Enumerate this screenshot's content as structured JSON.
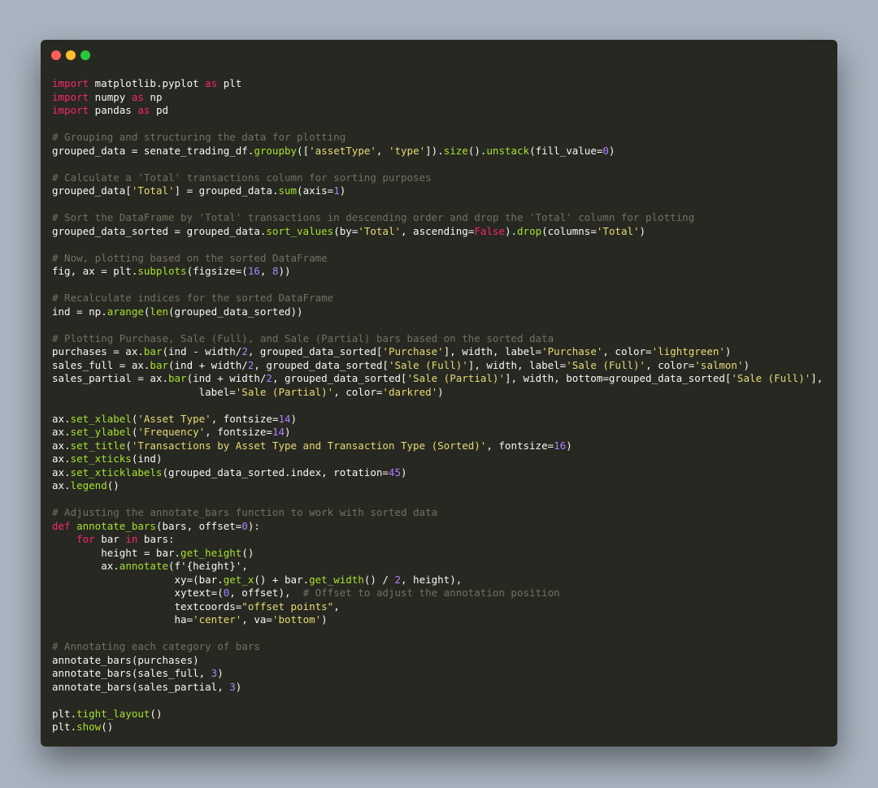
{
  "window": {
    "controls": [
      "close",
      "minimize",
      "maximize"
    ],
    "colors": {
      "close": "#ff5f56",
      "minimize": "#ffbd2e",
      "maximize": "#27c93f"
    }
  },
  "theme": {
    "background": "#272822",
    "page_background": "#a9b4c0",
    "colors": {
      "pl": "#f8f8f2",
      "kw": "#f92672",
      "fn": "#a6e22e",
      "str": "#e6db74",
      "num": "#ae81ff",
      "cm": "#75715e",
      "bool": "#ae81ff"
    }
  },
  "code_lines": [
    [
      [
        "kw",
        "import"
      ],
      [
        "pl",
        " matplotlib.pyplot "
      ],
      [
        "kw",
        "as"
      ],
      [
        "pl",
        " plt"
      ]
    ],
    [
      [
        "kw",
        "import"
      ],
      [
        "pl",
        " numpy "
      ],
      [
        "kw",
        "as"
      ],
      [
        "pl",
        " np"
      ]
    ],
    [
      [
        "kw",
        "import"
      ],
      [
        "pl",
        " pandas "
      ],
      [
        "kw",
        "as"
      ],
      [
        "pl",
        " pd"
      ]
    ],
    [],
    [
      [
        "cm",
        "# Grouping and structuring the data for plotting"
      ]
    ],
    [
      [
        "pl",
        "grouped_data = senate_trading_df."
      ],
      [
        "fn",
        "groupby"
      ],
      [
        "pl",
        "(["
      ],
      [
        "str",
        "'assetType'"
      ],
      [
        "pl",
        ", "
      ],
      [
        "str",
        "'type'"
      ],
      [
        "pl",
        "])."
      ],
      [
        "fn",
        "size"
      ],
      [
        "pl",
        "()."
      ],
      [
        "fn",
        "unstack"
      ],
      [
        "pl",
        "(fill_value="
      ],
      [
        "num",
        "0"
      ],
      [
        "pl",
        ")"
      ]
    ],
    [],
    [
      [
        "cm",
        "# Calculate a 'Total' transactions column for sorting purposes"
      ]
    ],
    [
      [
        "pl",
        "grouped_data["
      ],
      [
        "str",
        "'Total'"
      ],
      [
        "pl",
        "] = grouped_data."
      ],
      [
        "fn",
        "sum"
      ],
      [
        "pl",
        "(axis="
      ],
      [
        "num",
        "1"
      ],
      [
        "pl",
        ")"
      ]
    ],
    [],
    [
      [
        "cm",
        "# Sort the DataFrame by 'Total' transactions in descending order and drop the 'Total' column for plotting"
      ]
    ],
    [
      [
        "pl",
        "grouped_data_sorted = grouped_data."
      ],
      [
        "fn",
        "sort_values"
      ],
      [
        "pl",
        "(by="
      ],
      [
        "str",
        "'Total'"
      ],
      [
        "pl",
        ", ascending="
      ],
      [
        "kw",
        "False"
      ],
      [
        "pl",
        ")."
      ],
      [
        "fn",
        "drop"
      ],
      [
        "pl",
        "(columns="
      ],
      [
        "str",
        "'Total'"
      ],
      [
        "pl",
        ")"
      ]
    ],
    [],
    [
      [
        "cm",
        "# Now, plotting based on the sorted DataFrame"
      ]
    ],
    [
      [
        "pl",
        "fig, ax = plt."
      ],
      [
        "fn",
        "subplots"
      ],
      [
        "pl",
        "(figsize=("
      ],
      [
        "num",
        "16"
      ],
      [
        "pl",
        ", "
      ],
      [
        "num",
        "8"
      ],
      [
        "pl",
        "))"
      ]
    ],
    [],
    [
      [
        "cm",
        "# Recalculate indices for the sorted DataFrame"
      ]
    ],
    [
      [
        "pl",
        "ind = np."
      ],
      [
        "fn",
        "arange"
      ],
      [
        "pl",
        "("
      ],
      [
        "fn",
        "len"
      ],
      [
        "pl",
        "(grouped_data_sorted))"
      ]
    ],
    [],
    [
      [
        "cm",
        "# Plotting Purchase, Sale (Full), and Sale (Partial) bars based on the sorted data"
      ]
    ],
    [
      [
        "pl",
        "purchases = ax."
      ],
      [
        "fn",
        "bar"
      ],
      [
        "pl",
        "(ind - width/"
      ],
      [
        "num",
        "2"
      ],
      [
        "pl",
        ", grouped_data_sorted["
      ],
      [
        "str",
        "'Purchase'"
      ],
      [
        "pl",
        "], width, label="
      ],
      [
        "str",
        "'Purchase'"
      ],
      [
        "pl",
        ", color="
      ],
      [
        "str",
        "'lightgreen'"
      ],
      [
        "pl",
        ")"
      ]
    ],
    [
      [
        "pl",
        "sales_full = ax."
      ],
      [
        "fn",
        "bar"
      ],
      [
        "pl",
        "(ind + width/"
      ],
      [
        "num",
        "2"
      ],
      [
        "pl",
        ", grouped_data_sorted["
      ],
      [
        "str",
        "'Sale (Full)'"
      ],
      [
        "pl",
        "], width, label="
      ],
      [
        "str",
        "'Sale (Full)'"
      ],
      [
        "pl",
        ", color="
      ],
      [
        "str",
        "'salmon'"
      ],
      [
        "pl",
        ")"
      ]
    ],
    [
      [
        "pl",
        "sales_partial = ax."
      ],
      [
        "fn",
        "bar"
      ],
      [
        "pl",
        "(ind + width/"
      ],
      [
        "num",
        "2"
      ],
      [
        "pl",
        ", grouped_data_sorted["
      ],
      [
        "str",
        "'Sale (Partial)'"
      ],
      [
        "pl",
        "], width, bottom=grouped_data_sorted["
      ],
      [
        "str",
        "'Sale (Full)'"
      ],
      [
        "pl",
        "],"
      ]
    ],
    [
      [
        "pl",
        "                        label="
      ],
      [
        "str",
        "'Sale (Partial)'"
      ],
      [
        "pl",
        ", color="
      ],
      [
        "str",
        "'darkred'"
      ],
      [
        "pl",
        ")"
      ]
    ],
    [],
    [
      [
        "pl",
        "ax."
      ],
      [
        "fn",
        "set_xlabel"
      ],
      [
        "pl",
        "("
      ],
      [
        "str",
        "'Asset Type'"
      ],
      [
        "pl",
        ", fontsize="
      ],
      [
        "num",
        "14"
      ],
      [
        "pl",
        ")"
      ]
    ],
    [
      [
        "pl",
        "ax."
      ],
      [
        "fn",
        "set_ylabel"
      ],
      [
        "pl",
        "("
      ],
      [
        "str",
        "'Frequency'"
      ],
      [
        "pl",
        ", fontsize="
      ],
      [
        "num",
        "14"
      ],
      [
        "pl",
        ")"
      ]
    ],
    [
      [
        "pl",
        "ax."
      ],
      [
        "fn",
        "set_title"
      ],
      [
        "pl",
        "("
      ],
      [
        "str",
        "'Transactions by Asset Type and Transaction Type (Sorted)'"
      ],
      [
        "pl",
        ", fontsize="
      ],
      [
        "num",
        "16"
      ],
      [
        "pl",
        ")"
      ]
    ],
    [
      [
        "pl",
        "ax."
      ],
      [
        "fn",
        "set_xticks"
      ],
      [
        "pl",
        "(ind)"
      ]
    ],
    [
      [
        "pl",
        "ax."
      ],
      [
        "fn",
        "set_xticklabels"
      ],
      [
        "pl",
        "(grouped_data_sorted.index, rotation="
      ],
      [
        "num",
        "45"
      ],
      [
        "pl",
        ")"
      ]
    ],
    [
      [
        "pl",
        "ax."
      ],
      [
        "fn",
        "legend"
      ],
      [
        "pl",
        "()"
      ]
    ],
    [],
    [
      [
        "cm",
        "# Adjusting the annotate_bars function to work with sorted data"
      ]
    ],
    [
      [
        "kw",
        "def"
      ],
      [
        "pl",
        " "
      ],
      [
        "fn",
        "annotate_bars"
      ],
      [
        "pl",
        "(bars, offset="
      ],
      [
        "num",
        "0"
      ],
      [
        "pl",
        "):"
      ]
    ],
    [
      [
        "pl",
        "    "
      ],
      [
        "kw",
        "for"
      ],
      [
        "pl",
        " bar "
      ],
      [
        "kw",
        "in"
      ],
      [
        "pl",
        " bars:"
      ]
    ],
    [
      [
        "pl",
        "        height = bar."
      ],
      [
        "fn",
        "get_height"
      ],
      [
        "pl",
        "()"
      ]
    ],
    [
      [
        "pl",
        "        ax."
      ],
      [
        "fn",
        "annotate"
      ],
      [
        "pl",
        "(f'{height}',"
      ]
    ],
    [
      [
        "pl",
        "                    xy=(bar."
      ],
      [
        "fn",
        "get_x"
      ],
      [
        "pl",
        "() + bar."
      ],
      [
        "fn",
        "get_width"
      ],
      [
        "pl",
        "() / "
      ],
      [
        "num",
        "2"
      ],
      [
        "pl",
        ", height),"
      ]
    ],
    [
      [
        "pl",
        "                    xytext=("
      ],
      [
        "num",
        "0"
      ],
      [
        "pl",
        ", offset),  "
      ],
      [
        "cm",
        "# Offset to adjust the annotation position"
      ]
    ],
    [
      [
        "pl",
        "                    textcoords="
      ],
      [
        "str",
        "\"offset points\""
      ],
      [
        "pl",
        ","
      ]
    ],
    [
      [
        "pl",
        "                    ha="
      ],
      [
        "str",
        "'center'"
      ],
      [
        "pl",
        ", va="
      ],
      [
        "str",
        "'bottom'"
      ],
      [
        "pl",
        ")"
      ]
    ],
    [],
    [
      [
        "cm",
        "# Annotating each category of bars"
      ]
    ],
    [
      [
        "pl",
        "annotate_bars(purchases)"
      ]
    ],
    [
      [
        "pl",
        "annotate_bars(sales_full, "
      ],
      [
        "num",
        "3"
      ],
      [
        "pl",
        ")"
      ]
    ],
    [
      [
        "pl",
        "annotate_bars(sales_partial, "
      ],
      [
        "num",
        "3"
      ],
      [
        "pl",
        ")"
      ]
    ],
    [],
    [
      [
        "pl",
        "plt."
      ],
      [
        "fn",
        "tight_layout"
      ],
      [
        "pl",
        "()"
      ]
    ],
    [
      [
        "pl",
        "plt."
      ],
      [
        "fn",
        "show"
      ],
      [
        "pl",
        "()"
      ]
    ]
  ]
}
